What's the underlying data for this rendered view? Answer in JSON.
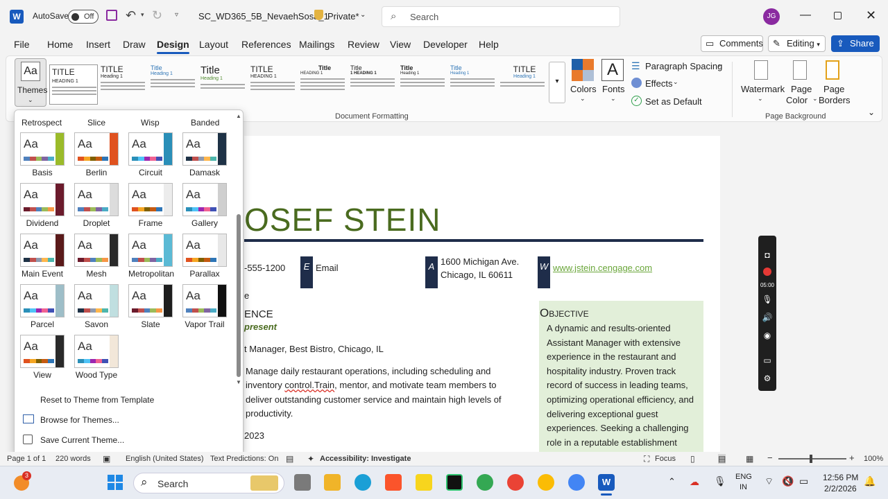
{
  "titlebar": {
    "autosave_label": "AutoSave",
    "autosave_state": "Off",
    "file_name": "SC_WD365_5B_NevaehSosa_1",
    "privacy": "Private*",
    "search_placeholder": "Search",
    "user_initials": "JG"
  },
  "menu": {
    "items": [
      "File",
      "Home",
      "Insert",
      "Draw",
      "Design",
      "Layout",
      "References",
      "Mailings",
      "Review",
      "View",
      "Developer",
      "Help"
    ],
    "active": "Design",
    "comments_label": "Comments",
    "editing_label": "Editing",
    "share_label": "Share"
  },
  "ribbon": {
    "themes_label": "Themes",
    "styles": [
      {
        "title": "TITLE",
        "heading": "HEADING 1"
      },
      {
        "title": "TITLE",
        "heading": "Heading 1"
      },
      {
        "title": "Title",
        "heading": "Heading 1"
      },
      {
        "title": "Title",
        "heading": "Heading 1"
      },
      {
        "title": "TITLE",
        "heading": "HEADING 1"
      },
      {
        "title": "Title",
        "heading": "HEADING 1"
      },
      {
        "title": "Title",
        "heading": "1 HEADING 1"
      },
      {
        "title": "Title",
        "heading": "Heading 1"
      },
      {
        "title": "Title",
        "heading": "Heading 1"
      },
      {
        "title": "TITLE",
        "heading": "Heading 1"
      }
    ],
    "colors_label": "Colors",
    "fonts_label": "Fonts",
    "paragraph_spacing_label": "Paragraph Spacing",
    "effects_label": "Effects",
    "set_default_label": "Set as Default",
    "document_formatting_label": "Document Formatting",
    "watermark_label": "Watermark",
    "page_color_label1": "Page",
    "page_color_label2": "Color",
    "page_borders_label1": "Page",
    "page_borders_label2": "Borders",
    "page_background_label": "Page Background"
  },
  "themes_panel": {
    "top_row": [
      "Retrospect",
      "Slice",
      "Wisp",
      "Banded"
    ],
    "themes": [
      {
        "name": "Basis",
        "bar": "#9bbb2a"
      },
      {
        "name": "Berlin",
        "bar": "#e0521f"
      },
      {
        "name": "Circuit",
        "bar": "#2a8fb8"
      },
      {
        "name": "Damask",
        "bar": "#1e3246"
      },
      {
        "name": "Dividend",
        "bar": "#6b1b2c"
      },
      {
        "name": "Droplet",
        "bar": "#dcdcdc"
      },
      {
        "name": "Frame",
        "bar": "#ececec"
      },
      {
        "name": "Gallery",
        "bar": "#cfcfcf"
      },
      {
        "name": "Main Event",
        "bar": "#5a1a1a"
      },
      {
        "name": "Mesh",
        "bar": "#2a2a2a"
      },
      {
        "name": "Metropolitan",
        "bar": "#5bbad5"
      },
      {
        "name": "Parallax",
        "bar": "#e8e8e8"
      },
      {
        "name": "Parcel",
        "bar": "#9ebec8"
      },
      {
        "name": "Savon",
        "bar": "#c0dfe0"
      },
      {
        "name": "Slate",
        "bar": "#1e1e1e"
      },
      {
        "name": "Vapor Trail",
        "bar": "#101010"
      },
      {
        "name": "View",
        "bar": "#2a2a2a"
      },
      {
        "name": "Wood Type",
        "bar": "#f2e7d9"
      }
    ],
    "reset_label": "Reset to Theme from Template",
    "browse_label": "Browse for Themes...",
    "save_label": "Save Current Theme..."
  },
  "document": {
    "name_partial": "OSEF STEIN",
    "phone_partial": "-555-1200",
    "email_letter": "E",
    "email_label": "Email",
    "address_letter": "A",
    "address_line1": "1600 Michigan Ave.",
    "address_line2": "Chicago, IL 60611",
    "web_letter": "W",
    "web_url": "www.jstein.cengage.com",
    "fragment_e": "e",
    "experience_partial": "ENCE",
    "present_label": "present",
    "job_line": "t Manager, Best Bistro, Chicago, IL",
    "bullet1_line1": "Manage daily restaurant operations, including scheduling and",
    "bullet1_line2_a": "inventory ",
    "bullet1_line2_err": "control.Train",
    "bullet1_line2_b": ", mentor, and motivate team members to",
    "bullet1_line3": "deliver outstanding customer service and maintain high levels of",
    "bullet1_line4": "productivity.",
    "year": "2023",
    "objective_title": "Objective",
    "objective_lines": [
      "A dynamic and results-oriented",
      "Assistant Manager with extensive",
      "experience in the restaurant and",
      "hospitality industry. Proven track",
      "record of success in leading teams,",
      "optimizing operational efficiency, and",
      "delivering exceptional guest",
      "experiences. Seeking a challenging",
      "role in a reputable establishment"
    ]
  },
  "statusbar": {
    "page": "Page 1 of 1",
    "words": "220 words",
    "language": "English (United States)",
    "predictions": "Text Predictions: On",
    "accessibility": "Accessibility: Investigate",
    "focus": "Focus",
    "zoom": "100%"
  },
  "recorder": {
    "time": "05:00"
  },
  "taskbar": {
    "search_placeholder": "Search",
    "lang1": "ENG",
    "lang2": "IN",
    "time": "12:56 PM",
    "date": "2/2/2026",
    "badge": "3"
  },
  "colors": {
    "accent": "#185abd",
    "name_green": "#4a6b1f",
    "navy": "#1f2d4a",
    "objective_bg": "#e2efd9",
    "link_green": "#6aa63a"
  }
}
